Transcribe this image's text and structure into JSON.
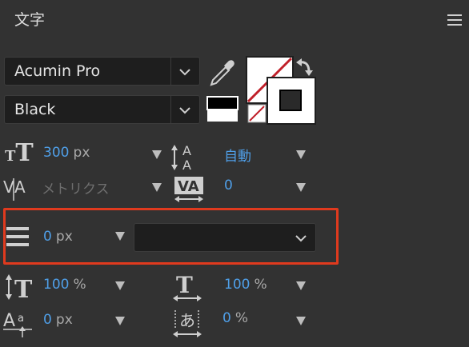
{
  "panel": {
    "title": "文字"
  },
  "font": {
    "family": "Acumin Pro",
    "style": "Black"
  },
  "fields": {
    "font_size": {
      "value": "300",
      "unit": "px"
    },
    "leading": {
      "value": "自動"
    },
    "kerning": {
      "value": "メトリクス"
    },
    "tracking": {
      "value": "0"
    },
    "indent": {
      "value": "0",
      "unit": "px"
    },
    "vertical_scale": {
      "value": "100",
      "unit": "%"
    },
    "horizontal_scale": {
      "value": "100",
      "unit": "%"
    },
    "baseline_shift": {
      "value": "0",
      "unit": "px"
    },
    "tsume": {
      "value": "0",
      "unit": "%"
    }
  },
  "colors": {
    "background": "#323232",
    "value_blue": "#4f9fe8",
    "highlight_red": "#e03a1e",
    "fill_color": "#000000",
    "stroke_color": "#ffffff"
  },
  "icons": [
    "menu-icon",
    "chevron-down-icon",
    "eyedropper-icon",
    "swap-colors-icon",
    "font-size-icon",
    "leading-icon",
    "kerning-icon",
    "tracking-icon",
    "paragraph-align-icon",
    "vertical-scale-icon",
    "horizontal-scale-icon",
    "baseline-shift-icon",
    "tsume-icon",
    "triangle-down-icon",
    "no-color-icon"
  ]
}
